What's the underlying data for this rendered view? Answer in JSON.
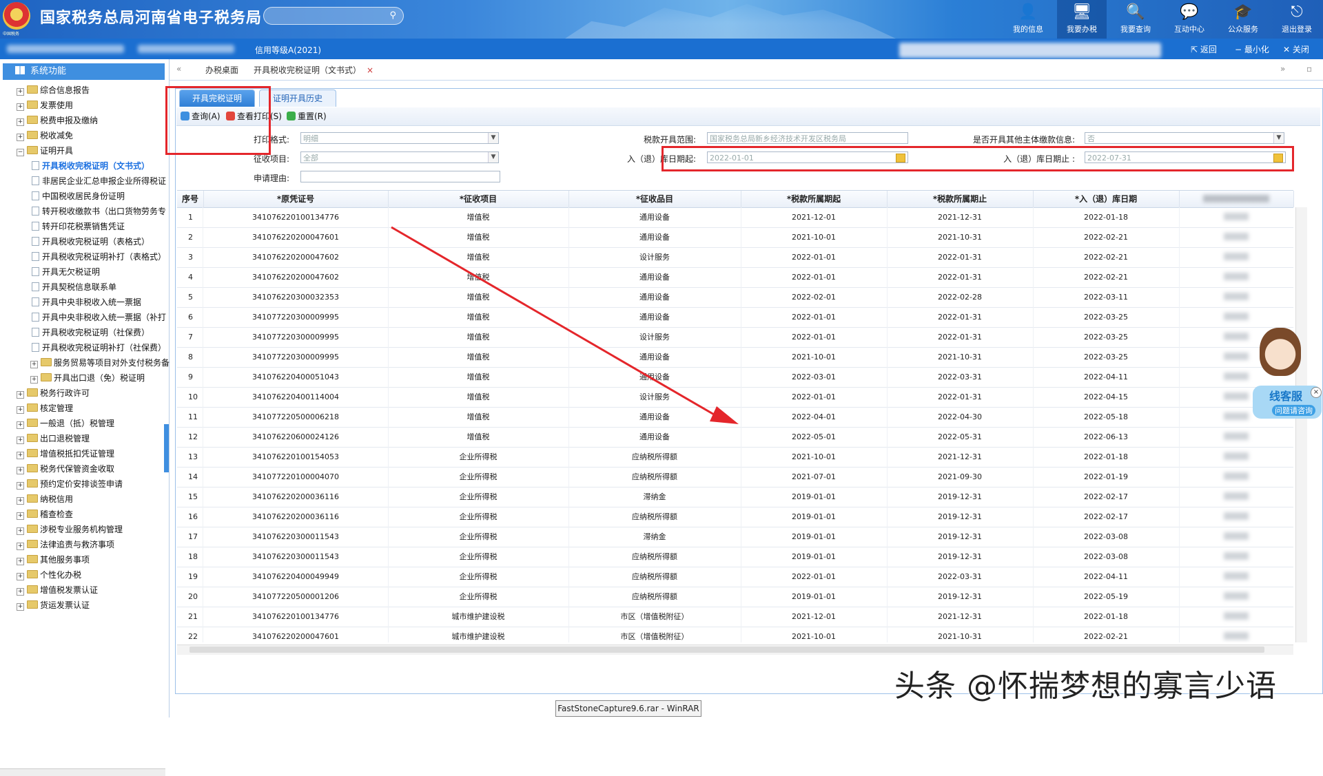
{
  "banner": {
    "site_title": "国家税务总局河南省电子税务局",
    "emblem_caption": "中国税务",
    "search_placeholder": "",
    "nav": [
      {
        "label": "我的信息",
        "icon": "user-icon"
      },
      {
        "label": "我要办税",
        "icon": "monitor-icon"
      },
      {
        "label": "我要查询",
        "icon": "search-doc-icon"
      },
      {
        "label": "互动中心",
        "icon": "chat-icon"
      },
      {
        "label": "公众服务",
        "icon": "hat-icon"
      },
      {
        "label": "退出登录",
        "icon": "logout-icon"
      }
    ]
  },
  "subbar": {
    "credit_level": "信用等级A(2021)",
    "back_label": "返回",
    "minimize_label": "最小化",
    "close_label": "关闭"
  },
  "sidebar": {
    "header": "系统功能",
    "items": [
      {
        "label": "综合信息报告",
        "level": 0,
        "expander": "+"
      },
      {
        "label": "发票使用",
        "level": 0,
        "expander": "+"
      },
      {
        "label": "税费申报及缴纳",
        "level": 0,
        "expander": "+"
      },
      {
        "label": "税收减免",
        "level": 0,
        "expander": "+"
      },
      {
        "label": "证明开具",
        "level": 0,
        "expander": "-"
      },
      {
        "label": "开具税收完税证明（文书式）",
        "level": 1,
        "selected": true
      },
      {
        "label": "非居民企业汇总申报企业所得税证",
        "level": 1
      },
      {
        "label": "中国税收居民身份证明",
        "level": 1
      },
      {
        "label": "转开税收缴款书（出口货物劳务专",
        "level": 1
      },
      {
        "label": "转开印花税票销售凭证",
        "level": 1
      },
      {
        "label": "开具税收完税证明（表格式）",
        "level": 1
      },
      {
        "label": "开具税收完税证明补打（表格式）",
        "level": 1
      },
      {
        "label": "开具无欠税证明",
        "level": 1
      },
      {
        "label": "开具契税信息联系单",
        "level": 1
      },
      {
        "label": "开具中央非税收入统一票据",
        "level": 1
      },
      {
        "label": "开具中央非税收入统一票据（补打",
        "level": 1
      },
      {
        "label": "开具税收完税证明（社保费）",
        "level": 1
      },
      {
        "label": "开具税收完税证明补打（社保费）",
        "level": 1
      },
      {
        "label": "服务贸易等项目对外支付税务备",
        "level": 2,
        "expander": "+"
      },
      {
        "label": "开具出口退（免）税证明",
        "level": 2,
        "expander": "+"
      },
      {
        "label": "税务行政许可",
        "level": 0,
        "expander": "+"
      },
      {
        "label": "核定管理",
        "level": 0,
        "expander": "+"
      },
      {
        "label": "一般退（抵）税管理",
        "level": 0,
        "expander": "+"
      },
      {
        "label": "出口退税管理",
        "level": 0,
        "expander": "+"
      },
      {
        "label": "增值税抵扣凭证管理",
        "level": 0,
        "expander": "+"
      },
      {
        "label": "税务代保管资金收取",
        "level": 0,
        "expander": "+"
      },
      {
        "label": "预约定价安排谈签申请",
        "level": 0,
        "expander": "+"
      },
      {
        "label": "纳税信用",
        "level": 0,
        "expander": "+"
      },
      {
        "label": "稽查检查",
        "level": 0,
        "expander": "+"
      },
      {
        "label": "涉税专业服务机构管理",
        "level": 0,
        "expander": "+"
      },
      {
        "label": "法律追责与救济事项",
        "level": 0,
        "expander": "+"
      },
      {
        "label": "其他服务事项",
        "level": 0,
        "expander": "+"
      },
      {
        "label": "个性化办税",
        "level": 0,
        "expander": "+"
      },
      {
        "label": "增值税发票认证",
        "level": 0,
        "expander": "+"
      },
      {
        "label": "货运发票认证",
        "level": 0,
        "expander": "+"
      }
    ]
  },
  "tabs": {
    "home": "办税桌面",
    "current": "开具税收完税证明（文书式）",
    "close_glyph": "×"
  },
  "subtabs": [
    "开具完税证明",
    "证明开具历史"
  ],
  "toolbar": {
    "query": "查询(A)",
    "print": "查看打印(S)",
    "reset": "重置(R)"
  },
  "form": {
    "print_format_label": "打印格式:",
    "print_format_value": "明细",
    "tax_scope_label": "税款开具范围:",
    "tax_scope_value": "国家税务总局新乡经济技术开发区税务局",
    "other_entity_label": "是否开具其他主体缴款信息:",
    "other_entity_value": "否",
    "levy_item_label": "征收项目:",
    "levy_item_value": "全部",
    "date_start_label": "入（退）库日期起:",
    "date_start_value": "2022-01-01",
    "date_end_label": "入（退）库日期止 :",
    "date_end_value": "2022-07-31",
    "reason_label": "申请理由:"
  },
  "grid": {
    "headers": [
      "序号",
      "*原凭证号",
      "*征收项目",
      "*征收品目",
      "*税款所属期起",
      "*税款所属期止",
      "*入（退）库日期"
    ],
    "rows": [
      [
        "1",
        "341076220100134776",
        "增值税",
        "通用设备",
        "2021-12-01",
        "2021-12-31",
        "2022-01-18"
      ],
      [
        "2",
        "341076220200047601",
        "增值税",
        "通用设备",
        "2021-10-01",
        "2021-10-31",
        "2022-02-21"
      ],
      [
        "3",
        "341076220200047602",
        "增值税",
        "设计服务",
        "2022-01-01",
        "2022-01-31",
        "2022-02-21"
      ],
      [
        "4",
        "341076220200047602",
        "增值税",
        "通用设备",
        "2022-01-01",
        "2022-01-31",
        "2022-02-21"
      ],
      [
        "5",
        "341076220300032353",
        "增值税",
        "通用设备",
        "2022-02-01",
        "2022-02-28",
        "2022-03-11"
      ],
      [
        "6",
        "341077220300009995",
        "增值税",
        "通用设备",
        "2022-01-01",
        "2022-01-31",
        "2022-03-25"
      ],
      [
        "7",
        "341077220300009995",
        "增值税",
        "设计服务",
        "2022-01-01",
        "2022-01-31",
        "2022-03-25"
      ],
      [
        "8",
        "341077220300009995",
        "增值税",
        "通用设备",
        "2021-10-01",
        "2021-10-31",
        "2022-03-25"
      ],
      [
        "9",
        "341076220400051043",
        "增值税",
        "通用设备",
        "2022-03-01",
        "2022-03-31",
        "2022-04-11"
      ],
      [
        "10",
        "341076220400114004",
        "增值税",
        "设计服务",
        "2022-01-01",
        "2022-01-31",
        "2022-04-15"
      ],
      [
        "11",
        "341077220500006218",
        "增值税",
        "通用设备",
        "2022-04-01",
        "2022-04-30",
        "2022-05-18"
      ],
      [
        "12",
        "341076220600024126",
        "增值税",
        "通用设备",
        "2022-05-01",
        "2022-05-31",
        "2022-06-13"
      ],
      [
        "13",
        "341076220100154053",
        "企业所得税",
        "应纳税所得额",
        "2021-10-01",
        "2021-12-31",
        "2022-01-18"
      ],
      [
        "14",
        "341077220100004070",
        "企业所得税",
        "应纳税所得额",
        "2021-07-01",
        "2021-09-30",
        "2022-01-19"
      ],
      [
        "15",
        "341076220200036116",
        "企业所得税",
        "滞纳金",
        "2019-01-01",
        "2019-12-31",
        "2022-02-17"
      ],
      [
        "16",
        "341076220200036116",
        "企业所得税",
        "应纳税所得额",
        "2019-01-01",
        "2019-12-31",
        "2022-02-17"
      ],
      [
        "17",
        "341076220300011543",
        "企业所得税",
        "滞纳金",
        "2019-01-01",
        "2019-12-31",
        "2022-03-08"
      ],
      [
        "18",
        "341076220300011543",
        "企业所得税",
        "应纳税所得额",
        "2019-01-01",
        "2019-12-31",
        "2022-03-08"
      ],
      [
        "19",
        "341076220400049949",
        "企业所得税",
        "应纳税所得额",
        "2022-01-01",
        "2022-03-31",
        "2022-04-11"
      ],
      [
        "20",
        "341077220500001206",
        "企业所得税",
        "应纳税所得额",
        "2019-01-01",
        "2019-12-31",
        "2022-05-19"
      ],
      [
        "21",
        "341076220100134776",
        "城市维护建设税",
        "市区（增值税附征）",
        "2021-12-01",
        "2021-12-31",
        "2022-01-18"
      ],
      [
        "22",
        "341076220200047601",
        "城市维护建设税",
        "市区（增值税附征）",
        "2021-10-01",
        "2021-10-31",
        "2022-02-21"
      ]
    ]
  },
  "cs_widget": {
    "title": "线客服",
    "subtitle": "问题请咨询",
    "close": "×"
  },
  "watermark": "头条 @怀揣梦想的寡言少语",
  "taskbar_item": "FastStoneCapture9.6.rar - WinRAR",
  "colors": {
    "annotation_red": "#e4262b",
    "brand_blue": "#1b6fd1"
  }
}
